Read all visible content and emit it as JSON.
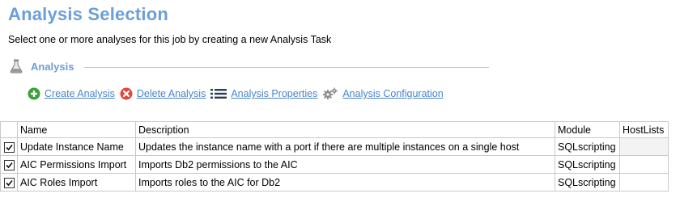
{
  "header": {
    "title": "Analysis Selection",
    "subtitle": "Select one or more analyses for this job by creating a new Analysis Task"
  },
  "section": {
    "label": "Analysis",
    "icon": "flask-icon"
  },
  "toolbar": {
    "create": {
      "label": "Create Analysis",
      "icon": "plus-circle-icon",
      "color": "#3aa13a"
    },
    "delete": {
      "label": "Delete Analysis",
      "icon": "x-circle-icon",
      "color": "#e0483c"
    },
    "properties": {
      "label": "Analysis Properties",
      "icon": "list-icon"
    },
    "configuration": {
      "label": "Analysis Configuration",
      "icon": "gears-icon"
    }
  },
  "table": {
    "columns": [
      "Name",
      "Description",
      "Module",
      "HostLists"
    ],
    "rows": [
      {
        "checked": true,
        "name": "Update Instance Name",
        "description": "Updates the instance name with a port if there are multiple instances on a single host",
        "module": "SQLscripting",
        "hostlists": ""
      },
      {
        "checked": true,
        "name": "AIC Permissions Import",
        "description": "Imports Db2 permissions to the AIC",
        "module": "SQLscripting",
        "hostlists": ""
      },
      {
        "checked": true,
        "name": "AIC Roles Import",
        "description": "Imports roles to the AIC for Db2",
        "module": "SQLscripting",
        "hostlists": ""
      }
    ]
  },
  "colors": {
    "accent": "#6a9fd8",
    "link": "#4a84c8",
    "grid_border": "#c9c9c9"
  }
}
